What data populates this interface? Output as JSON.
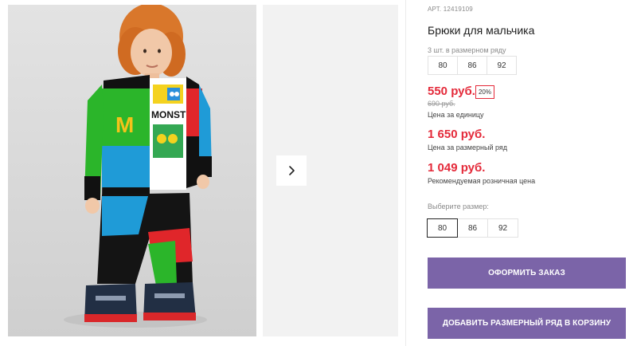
{
  "product": {
    "article": "АРТ. 12419109",
    "title": "Брюки для мальчика"
  },
  "pack": {
    "label": "3 шт. в размерном ряду",
    "sizes": [
      "80",
      "86",
      "92"
    ]
  },
  "prices": {
    "unit_price": "550 руб.",
    "discount": "20%",
    "old_price": "690 руб.",
    "unit_label": "Цена за единицу",
    "row_price": "1 650 руб.",
    "row_label": "Цена за размерный ряд",
    "rrp_price": "1 049 руб.",
    "rrp_label": "Рекомендуемая розничная цена"
  },
  "size_select": {
    "label": "Выберите размер:",
    "options": [
      "80",
      "86",
      "92"
    ],
    "selected": "80"
  },
  "actions": {
    "order_label": "ОФОРМИТЬ ЗАКАЗ",
    "cart_label": "ДОБАВИТЬ РАЗМЕРНЫЙ РЯД В КОРЗИНУ"
  },
  "gallery": {
    "next_icon": "chevron-right-icon",
    "print_text": "MONSTER"
  },
  "colors": {
    "accent": "#7b64a8",
    "price": "#e42a3a",
    "jacket_green": "#2bb52a",
    "jacket_blue": "#1f9bd7",
    "jacket_red": "#e0262a"
  }
}
